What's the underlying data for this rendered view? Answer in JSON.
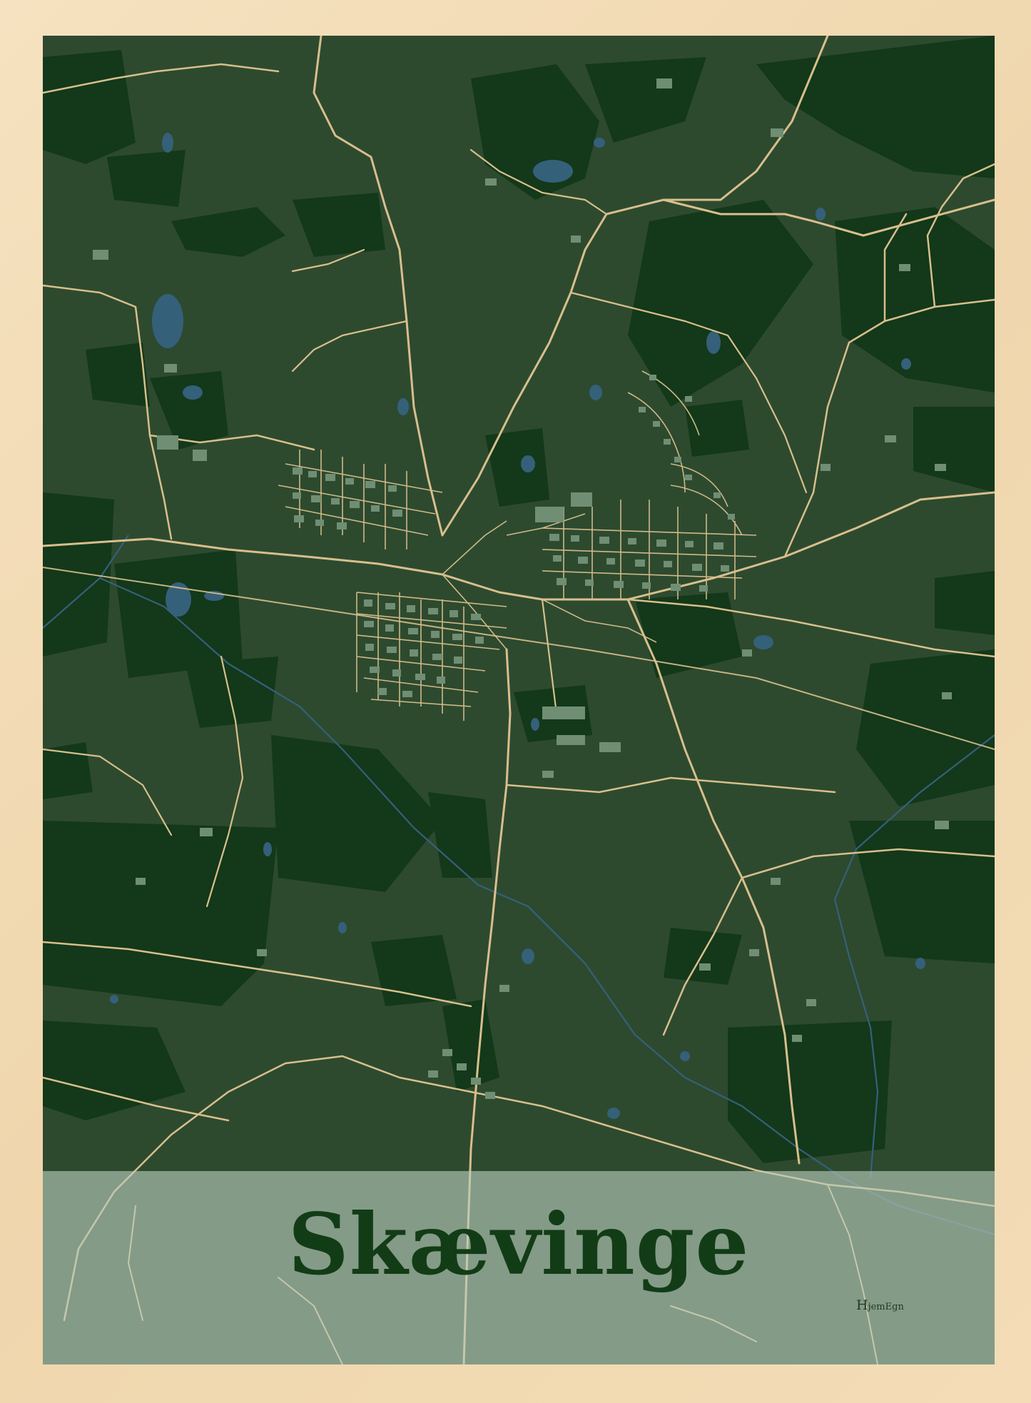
{
  "poster": {
    "place_name": "Skævinge",
    "brand": {
      "initial": "H",
      "rest": "jemEgn"
    }
  },
  "map": {
    "colors": {
      "frame": "#f3dcb6",
      "land": "#2d4a2f",
      "forest": "#13381a",
      "water": "#35607a",
      "road": "#d8bf8c",
      "building": "#6f8e73",
      "band": "#b9cdbe",
      "title": "#123c16"
    },
    "town": "Skævinge"
  }
}
